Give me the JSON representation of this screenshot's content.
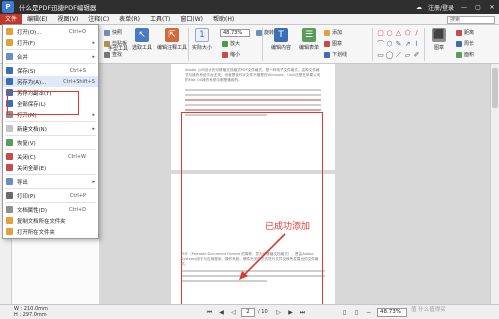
{
  "app": {
    "title": "什么是PDF迅捷PDF编辑器",
    "logo_letter": "P"
  },
  "titlebar_right": {
    "weather": "☁",
    "login": "注册/登录",
    "min": "—",
    "max": "▢",
    "close": "✕"
  },
  "menubar": {
    "items": [
      {
        "label": "文件",
        "active": true
      },
      {
        "label": "编辑(E)"
      },
      {
        "label": "视图(V)"
      },
      {
        "label": "注释(C)"
      },
      {
        "label": "表单(R)"
      },
      {
        "label": "工具(T)"
      },
      {
        "label": "窗口(W)"
      },
      {
        "label": "帮助(H)"
      }
    ],
    "search_placeholder": "搜索"
  },
  "ribbon": {
    "snapshot_label": "快照",
    "clipboard_label": "剪贴板",
    "find_label": "查找",
    "hand_tool_label": "手型工具",
    "select_tool_label": "选取工具",
    "annot_select_label": "编辑注释工具",
    "actual_size_label": "实际大小",
    "zoom_value": "48.73%",
    "zoom_in_label": "放大",
    "zoom_out_label": "缩小",
    "rotate_label": "旋转视图",
    "edit_content_label": "编辑内容",
    "edit_form_label": "编辑表单",
    "add_label": "添加",
    "stamp_label": "图章",
    "underline_label": "下划线",
    "distance_label": "距离",
    "perimeter_label": "周长",
    "area_label": "面积",
    "shape_glyphs": [
      "▢",
      "○",
      "△",
      "⬠",
      "∕",
      "⌒",
      "⬡",
      "✎",
      "↗",
      "⌇",
      "▭",
      "◯",
      "⟋",
      "▱",
      "✐"
    ]
  },
  "file_menu": {
    "items": [
      {
        "label": "打开(O)...",
        "shortcut": "Ctrl+O",
        "icon": "open-icon",
        "color": "#e2a23b"
      },
      {
        "label": "打开(F)",
        "arrow": "▸",
        "icon": "open-recent-icon",
        "color": "#e2a23b"
      },
      {
        "sep": true
      },
      {
        "label": "合并",
        "arrow": "▸",
        "icon": "merge-icon",
        "color": "#6c8ebf"
      },
      {
        "sep": true
      },
      {
        "label": "保存(S)",
        "shortcut": "Ctrl+S",
        "icon": "save-icon",
        "color": "#3a6fb5"
      },
      {
        "label": "另存为(A)...",
        "shortcut": "Ctrl+Shift+S",
        "icon": "save-as-icon",
        "color": "#3a6fb5",
        "hl": true
      },
      {
        "label": "另存为副本(Y)",
        "icon": "save-copy-icon",
        "color": "#3a6fb5"
      },
      {
        "label": "全部保存(L)",
        "icon": "save-all-icon",
        "color": "#3a6fb5"
      },
      {
        "label": "打开(M)",
        "arrow": "▸",
        "icon": "open-other-icon",
        "color": "#8e8e8e"
      },
      {
        "sep": true
      },
      {
        "label": "新建文档(N)",
        "arrow": "▸",
        "icon": "new-doc-icon",
        "color": "#c4c4c4"
      },
      {
        "sep": true
      },
      {
        "label": "恢复(V)",
        "icon": "restore-icon",
        "color": "#5b9c5b"
      },
      {
        "sep": true
      },
      {
        "label": "关闭(C)",
        "shortcut": "Ctrl+W",
        "icon": "close-doc-icon",
        "color": "#c94a4a"
      },
      {
        "label": "关闭全部(E)",
        "icon": "close-all-icon",
        "color": "#c94a4a"
      },
      {
        "sep": true
      },
      {
        "label": "导出",
        "arrow": "▸",
        "icon": "export-icon",
        "color": "#6c8ebf"
      },
      {
        "sep": true
      },
      {
        "label": "打印(P)",
        "shortcut": "Ctrl+P",
        "icon": "print-icon",
        "color": "#6a6a6a"
      },
      {
        "sep": true
      },
      {
        "label": "文档属性(D)",
        "shortcut": "Ctrl+D",
        "icon": "properties-icon",
        "color": "#8e8e8e"
      },
      {
        "label": "复制文档所在文件夹",
        "icon": "copy-path-icon",
        "color": "#e2a23b"
      },
      {
        "label": "打开所在文件夹",
        "icon": "folder-icon",
        "color": "#e2a23b"
      }
    ]
  },
  "document": {
    "page1_text": "Adobe 公司设计的可移植文档格式PDF文件格式，是一种电子文件格式。这种文件格式与操作系统平台无关，也就是说PDF文件不管是在Windows，Unix还是在苹果公司的Mac OS操作系统中都是通用的。",
    "page2_text": "PDF（Portable Document Format 的简称，意为可移植文档格式），是由Adobe Systems用于与应用程序、操作系统、硬件无关的方式进行文件交换所发展出的文件格式。",
    "annotation": "已成功添加"
  },
  "statusbar": {
    "page_size": "W : 210.0mm\nH : 297.0mm",
    "page_current": "2",
    "page_total": "/ 10",
    "zoom": "48.73%",
    "watermark": "值 什么值得买"
  }
}
